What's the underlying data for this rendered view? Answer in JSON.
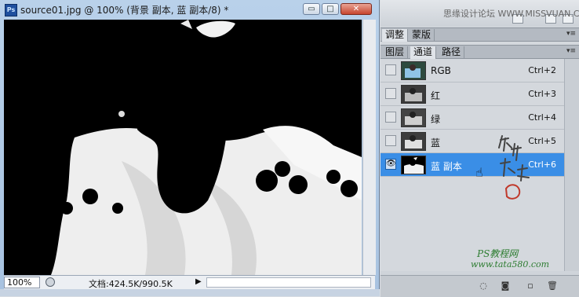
{
  "document": {
    "app_badge": "Ps",
    "title": "source01.jpg @ 100% (背景 副本, 蓝 副本/8) *",
    "minimize_glyph": "▭",
    "maximize_glyph": "□",
    "close_glyph": "✕",
    "zoom_value": "100%",
    "doc_size": "文档:424.5K/990.5K",
    "status_arrow": "▶"
  },
  "watermark": {
    "top_text": "思缘设计论坛 WWW.MISSVUAN.COM",
    "bottom_line1": "PS教程网",
    "bottom_line2": "www.tata580.com"
  },
  "panels": {
    "adjust_tabs": [
      {
        "label": "调整",
        "active": true
      },
      {
        "label": "蒙版",
        "active": false
      }
    ],
    "layers_tabs": [
      {
        "label": "图层",
        "active": false
      },
      {
        "label": "通道",
        "active": true
      },
      {
        "label": "路径",
        "active": false
      }
    ],
    "menu_glyph": "▾≡",
    "channels": [
      {
        "name": "RGB",
        "shortcut": "Ctrl+2",
        "visible": false,
        "selected": false,
        "thumb": "rgb"
      },
      {
        "name": "红",
        "shortcut": "Ctrl+3",
        "visible": false,
        "selected": false,
        "thumb": "gray"
      },
      {
        "name": "绿",
        "shortcut": "Ctrl+4",
        "visible": false,
        "selected": false,
        "thumb": "gray"
      },
      {
        "name": "蓝",
        "shortcut": "Ctrl+5",
        "visible": false,
        "selected": false,
        "thumb": "gray"
      },
      {
        "name": "蓝 副本",
        "shortcut": "Ctrl+6",
        "visible": true,
        "selected": true,
        "thumb": "mask"
      }
    ],
    "eye_glyph": "👁",
    "footer_buttons": [
      {
        "name": "load-selection",
        "glyph": "◌"
      },
      {
        "name": "save-selection",
        "glyph": "◙"
      },
      {
        "name": "new-channel",
        "glyph": "▫"
      },
      {
        "name": "delete-channel",
        "glyph": "🗑"
      }
    ]
  }
}
